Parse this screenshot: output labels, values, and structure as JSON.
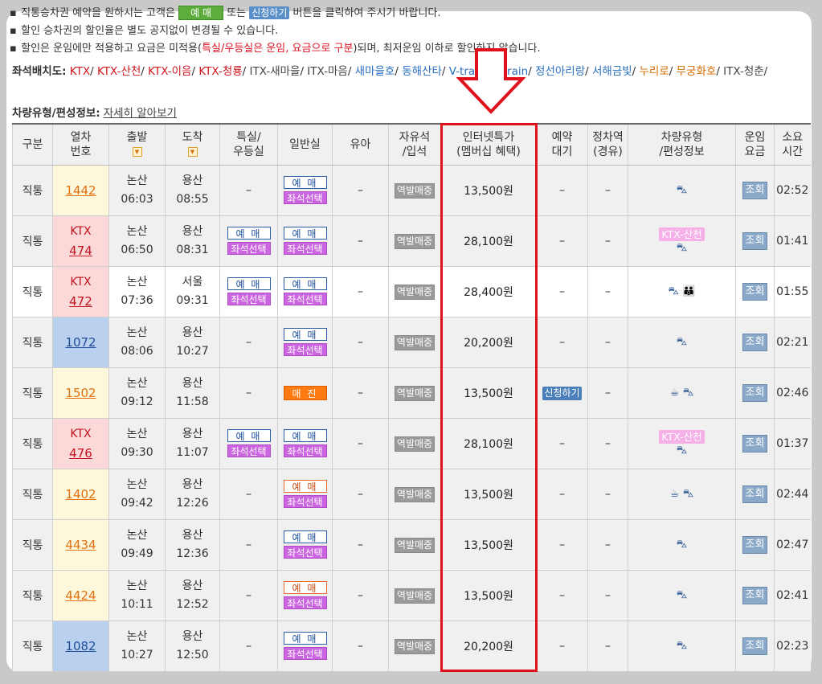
{
  "notes": {
    "line1_pre": "직통승차권 예약을 원하시는 고객은",
    "line1_btn1": "예 매",
    "line1_mid": "또는",
    "line1_btn2": "신청하기",
    "line1_post": "버튼을 클릭하여 주시기 바랍니다.",
    "line2": "할인 승차권의 할인율은 별도 공지없이 변경될 수 있습니다.",
    "line3_pre": "할인은 운임에만 적용하고 요금은 미적용(",
    "line3_red": "특실/우등실은 운임, 요금으로 구분",
    "line3_post": ")되며, 최저운임 이하로 할인하지 않습니다."
  },
  "seat_map": {
    "label": "좌석배치도:",
    "items": [
      {
        "text": "KTX",
        "color": "red"
      },
      {
        "text": "KTX-산천",
        "color": "red"
      },
      {
        "text": "KTX-이음",
        "color": "red"
      },
      {
        "text": "KTX-청룡",
        "color": "red"
      },
      {
        "text": "ITX-새마을",
        "color": "gray"
      },
      {
        "text": "ITX-마음",
        "color": "gray"
      },
      {
        "text": "새마을호",
        "color": "blue"
      },
      {
        "text": "동해산타",
        "color": "blue"
      },
      {
        "text": "V-train",
        "color": "blue"
      },
      {
        "text": "S-train",
        "color": "blue"
      },
      {
        "text": "정선아리랑",
        "color": "blue"
      },
      {
        "text": "서해금빛",
        "color": "blue"
      },
      {
        "text": "누리로",
        "color": "orange"
      },
      {
        "text": "무궁화호",
        "color": "orange"
      },
      {
        "text": "ITX-청춘",
        "color": "gray"
      }
    ]
  },
  "vehicle_info": {
    "label": "차량유형/편성정보:",
    "link": "자세히 알아보기"
  },
  "headers": {
    "type": "구분",
    "train_no": "열차\n번호",
    "depart": "출발",
    "arrive": "도착",
    "special": "특실/\n우등실",
    "general": "일반실",
    "infant": "유아",
    "free_seat": "자유석\n/입석",
    "internet": "인터넷특가\n(멤버십 혜택)",
    "waitlist": "예약\n대기",
    "stops": "정차역\n(경유)",
    "vehicle": "차량유형\n/편성정보",
    "fare": "운임\n요금",
    "duration": "소요\n시간"
  },
  "labels": {
    "reserve": "예 매",
    "seat_select": "좌석선택",
    "sold_out": "매 진",
    "station_sale": "역발매중",
    "apply": "신청하기",
    "query": "조회",
    "dash": "–"
  },
  "rows": [
    {
      "type": "직통",
      "train": "1442",
      "kind": "mugunghwa",
      "dep_st": "논산",
      "dep_t": "06:03",
      "arr_st": "용산",
      "arr_t": "08:55",
      "special": "none",
      "general": "reserve_blue",
      "fare": "13,500원",
      "wait": "none",
      "vehicle": [
        "bike"
      ],
      "ktx_tag": "",
      "duration": "02:52"
    },
    {
      "type": "직통",
      "train": "474",
      "kind": "ktx",
      "dep_st": "논산",
      "dep_t": "06:50",
      "arr_st": "용산",
      "arr_t": "08:31",
      "special": "reserve",
      "general": "reserve_blue",
      "fare": "28,100원",
      "wait": "none",
      "vehicle": [
        "bike"
      ],
      "ktx_tag": "KTX-산천",
      "duration": "01:41"
    },
    {
      "type": "직통",
      "train": "472",
      "kind": "ktx",
      "dep_st": "논산",
      "dep_t": "07:36",
      "arr_st": "서울",
      "arr_t": "09:31",
      "special": "reserve",
      "general": "reserve_blue",
      "fare": "28,400원",
      "wait": "none",
      "vehicle": [
        "bike",
        "family"
      ],
      "ktx_tag": "",
      "duration": "01:55"
    },
    {
      "type": "직통",
      "train": "1072",
      "kind": "itx",
      "dep_st": "논산",
      "dep_t": "08:06",
      "arr_st": "용산",
      "arr_t": "10:27",
      "special": "none",
      "general": "reserve_blue",
      "fare": "20,200원",
      "wait": "none",
      "vehicle": [
        "bike"
      ],
      "ktx_tag": "",
      "duration": "02:21"
    },
    {
      "type": "직통",
      "train": "1502",
      "kind": "mugunghwa",
      "dep_st": "논산",
      "dep_t": "09:12",
      "arr_st": "용산",
      "arr_t": "11:58",
      "special": "none",
      "general": "sold_out",
      "fare": "13,500원",
      "wait": "apply",
      "vehicle": [
        "cafe",
        "bike"
      ],
      "ktx_tag": "",
      "duration": "02:46"
    },
    {
      "type": "직통",
      "train": "476",
      "kind": "ktx",
      "dep_st": "논산",
      "dep_t": "09:30",
      "arr_st": "용산",
      "arr_t": "11:07",
      "special": "reserve",
      "general": "reserve_blue",
      "fare": "28,100원",
      "wait": "none",
      "vehicle": [
        "bike"
      ],
      "ktx_tag": "KTX-산천",
      "duration": "01:37"
    },
    {
      "type": "직통",
      "train": "1402",
      "kind": "mugunghwa",
      "dep_st": "논산",
      "dep_t": "09:42",
      "arr_st": "용산",
      "arr_t": "12:26",
      "special": "none",
      "general": "reserve_orange",
      "fare": "13,500원",
      "wait": "none",
      "vehicle": [
        "cafe",
        "bike"
      ],
      "ktx_tag": "",
      "duration": "02:44"
    },
    {
      "type": "직통",
      "train": "4434",
      "kind": "mugunghwa",
      "dep_st": "논산",
      "dep_t": "09:49",
      "arr_st": "용산",
      "arr_t": "12:36",
      "special": "none",
      "general": "reserve_blue",
      "fare": "13,500원",
      "wait": "none",
      "vehicle": [
        "bike"
      ],
      "ktx_tag": "",
      "duration": "02:47"
    },
    {
      "type": "직통",
      "train": "4424",
      "kind": "mugunghwa",
      "dep_st": "논산",
      "dep_t": "10:11",
      "arr_st": "용산",
      "arr_t": "12:52",
      "special": "none",
      "general": "reserve_orange",
      "fare": "13,500원",
      "wait": "none",
      "vehicle": [
        "bike"
      ],
      "ktx_tag": "",
      "duration": "02:41"
    },
    {
      "type": "직통",
      "train": "1082",
      "kind": "itx",
      "dep_st": "논산",
      "dep_t": "10:27",
      "arr_st": "용산",
      "arr_t": "12:50",
      "special": "none",
      "general": "reserve_blue",
      "fare": "20,200원",
      "wait": "none",
      "vehicle": [
        "bike"
      ],
      "ktx_tag": "",
      "duration": "02:23"
    }
  ],
  "colors": {
    "highlight": "#e0101c",
    "ktx_row": "#fbd9d9",
    "mugunghwa_row": "#fdf8dc",
    "itx_row": "#b9d0ef"
  }
}
